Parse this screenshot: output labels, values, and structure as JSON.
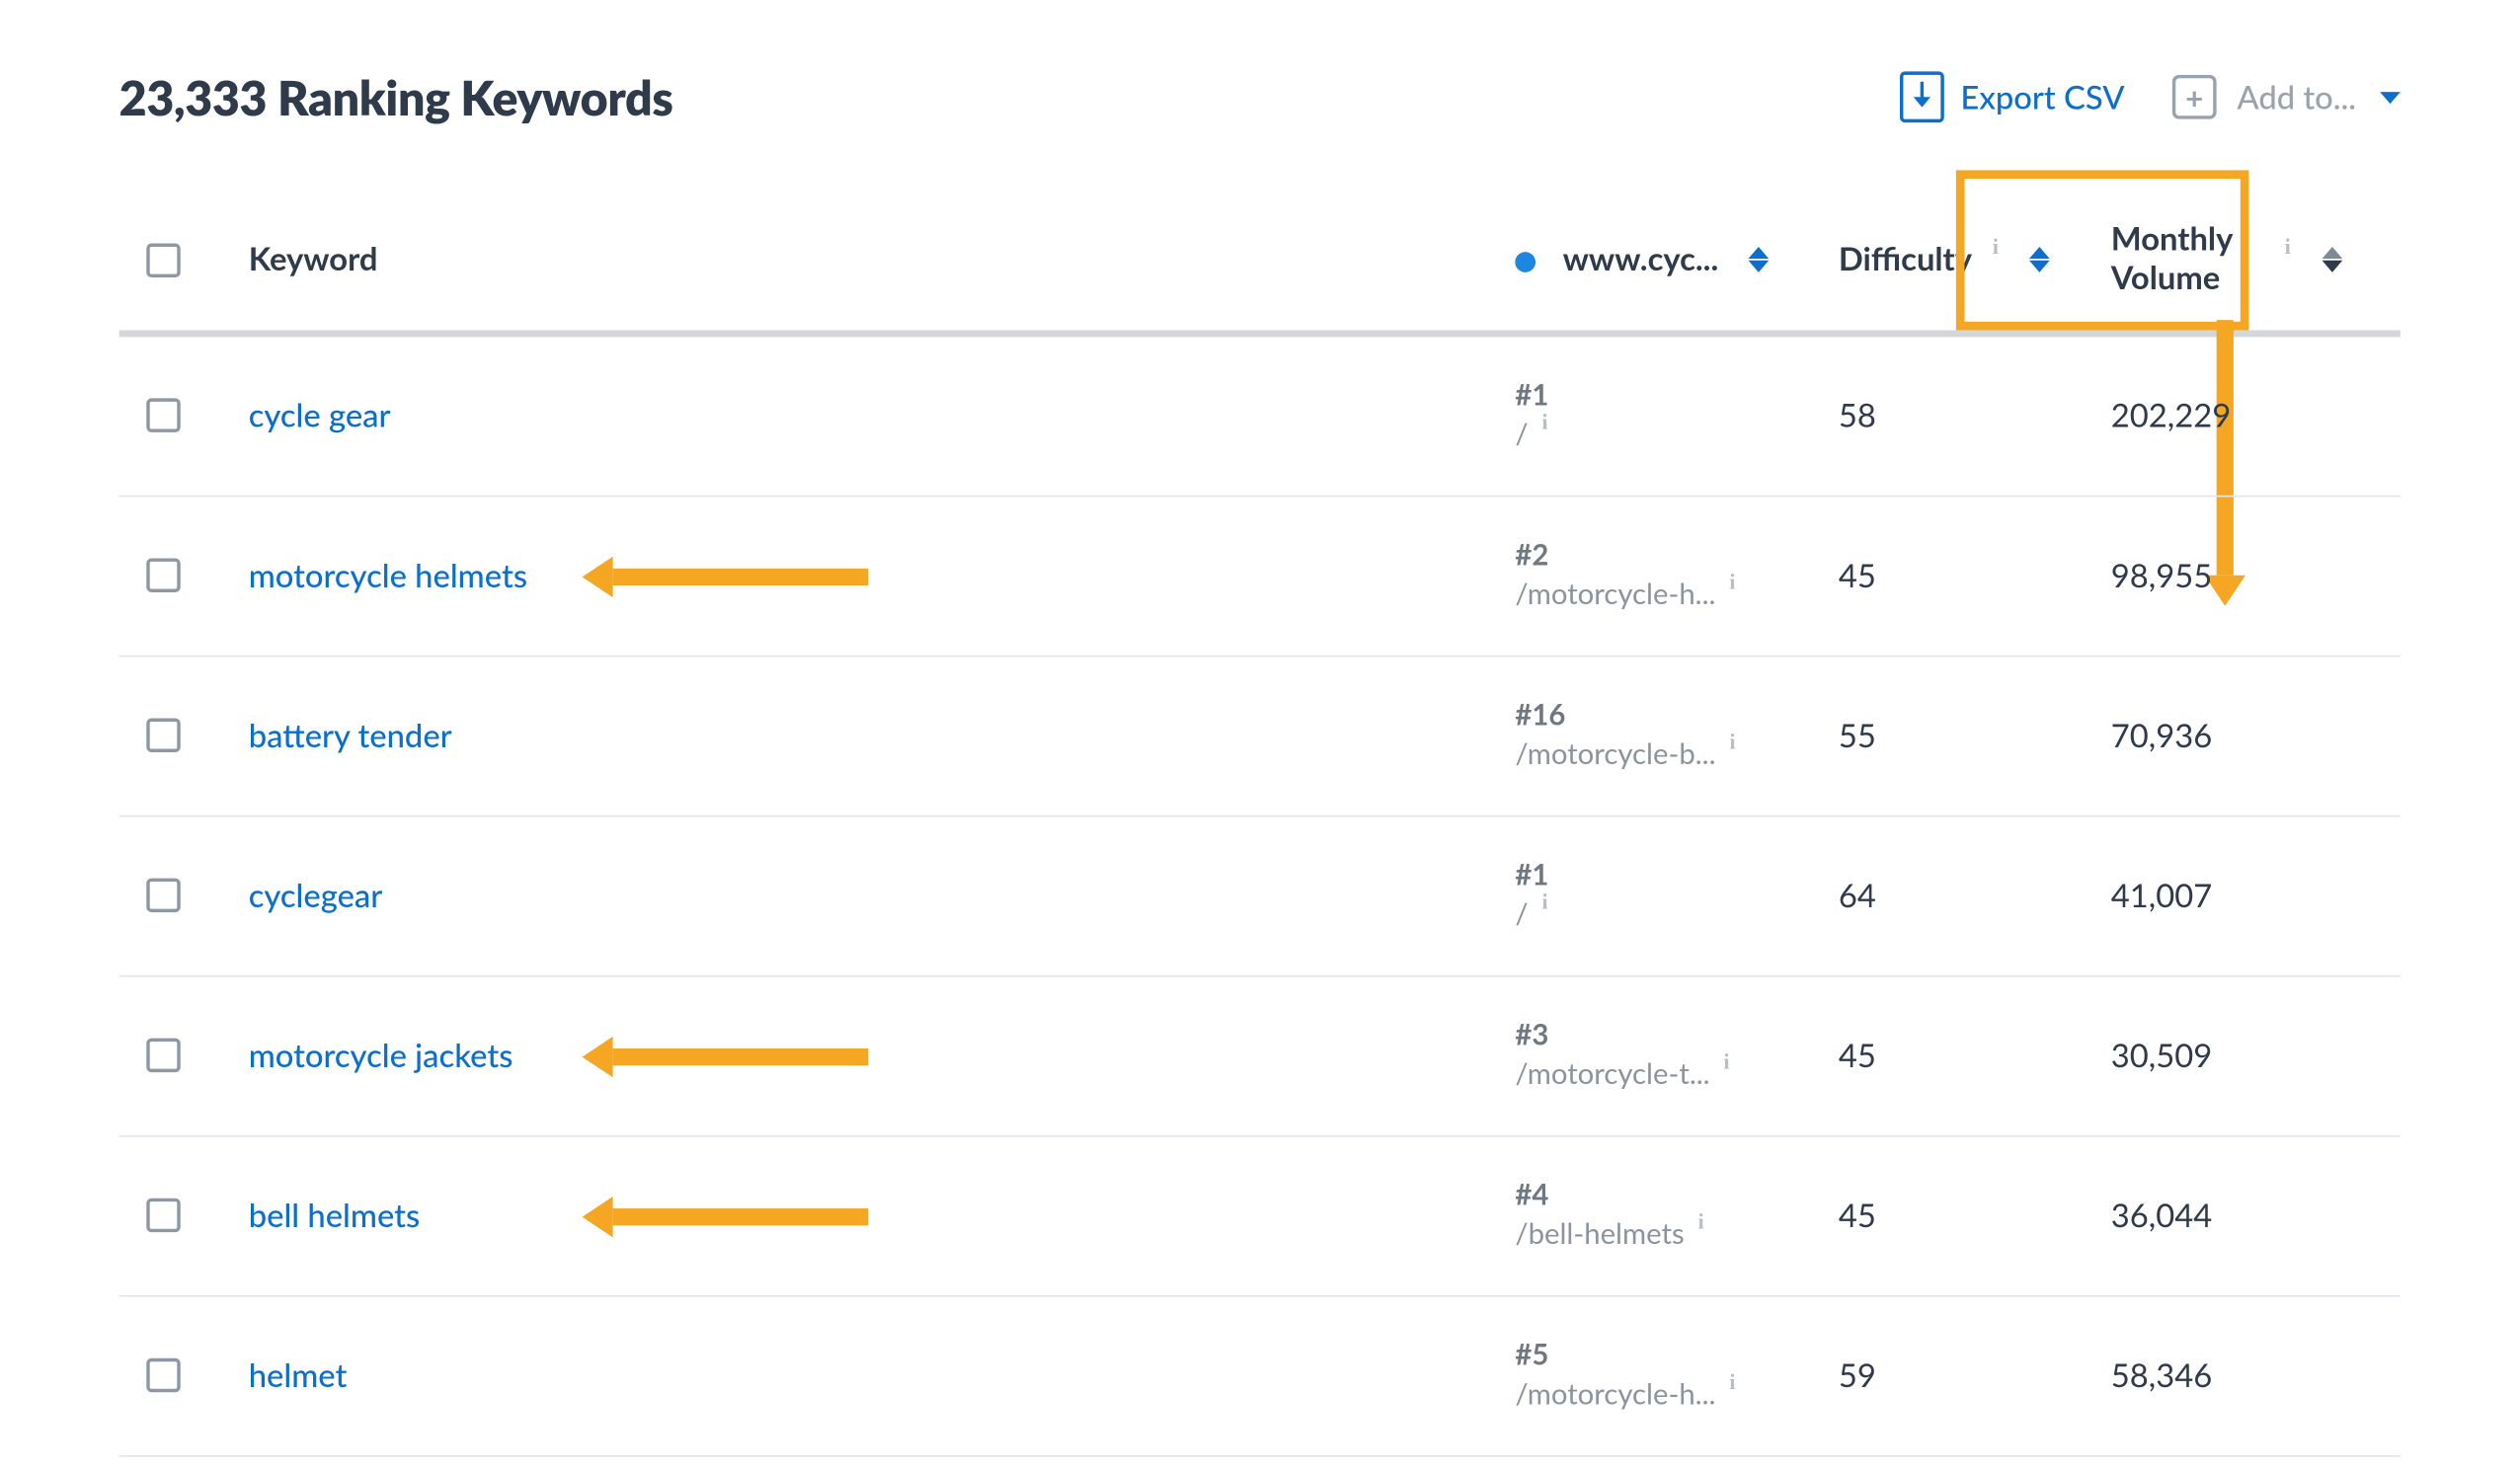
{
  "header": {
    "title": "23,333 Ranking Keywords",
    "export_label": "Export CSV",
    "addto_label": "Add to..."
  },
  "columns": {
    "keyword": "Keyword",
    "site": "www.cyc...",
    "difficulty": "Difficulty",
    "volume": "Monthly Volume"
  },
  "rows": [
    {
      "keyword": "cycle gear",
      "rank": "#1",
      "path": "/",
      "difficulty": "58",
      "volume": "202,229",
      "highlight": false
    },
    {
      "keyword": "motorcycle helmets",
      "rank": "#2",
      "path": "/motorcycle-h...",
      "difficulty": "45",
      "volume": "98,955",
      "highlight": true
    },
    {
      "keyword": "battery tender",
      "rank": "#16",
      "path": "/motorcycle-b...",
      "difficulty": "55",
      "volume": "70,936",
      "highlight": false
    },
    {
      "keyword": "cyclegear",
      "rank": "#1",
      "path": "/",
      "difficulty": "64",
      "volume": "41,007",
      "highlight": false
    },
    {
      "keyword": "motorcycle jackets",
      "rank": "#3",
      "path": "/motorcycle-t...",
      "difficulty": "45",
      "volume": "30,509",
      "highlight": true
    },
    {
      "keyword": "bell helmets",
      "rank": "#4",
      "path": "/bell-helmets",
      "difficulty": "45",
      "volume": "36,044",
      "highlight": true
    },
    {
      "keyword": "helmet",
      "rank": "#5",
      "path": "/motorcycle-h...",
      "difficulty": "59",
      "volume": "58,346",
      "highlight": false
    }
  ],
  "annotations": {
    "highlight_column": "volume",
    "arrow_targets": [
      "motorcycle helmets",
      "motorcycle jackets",
      "bell helmets"
    ]
  }
}
